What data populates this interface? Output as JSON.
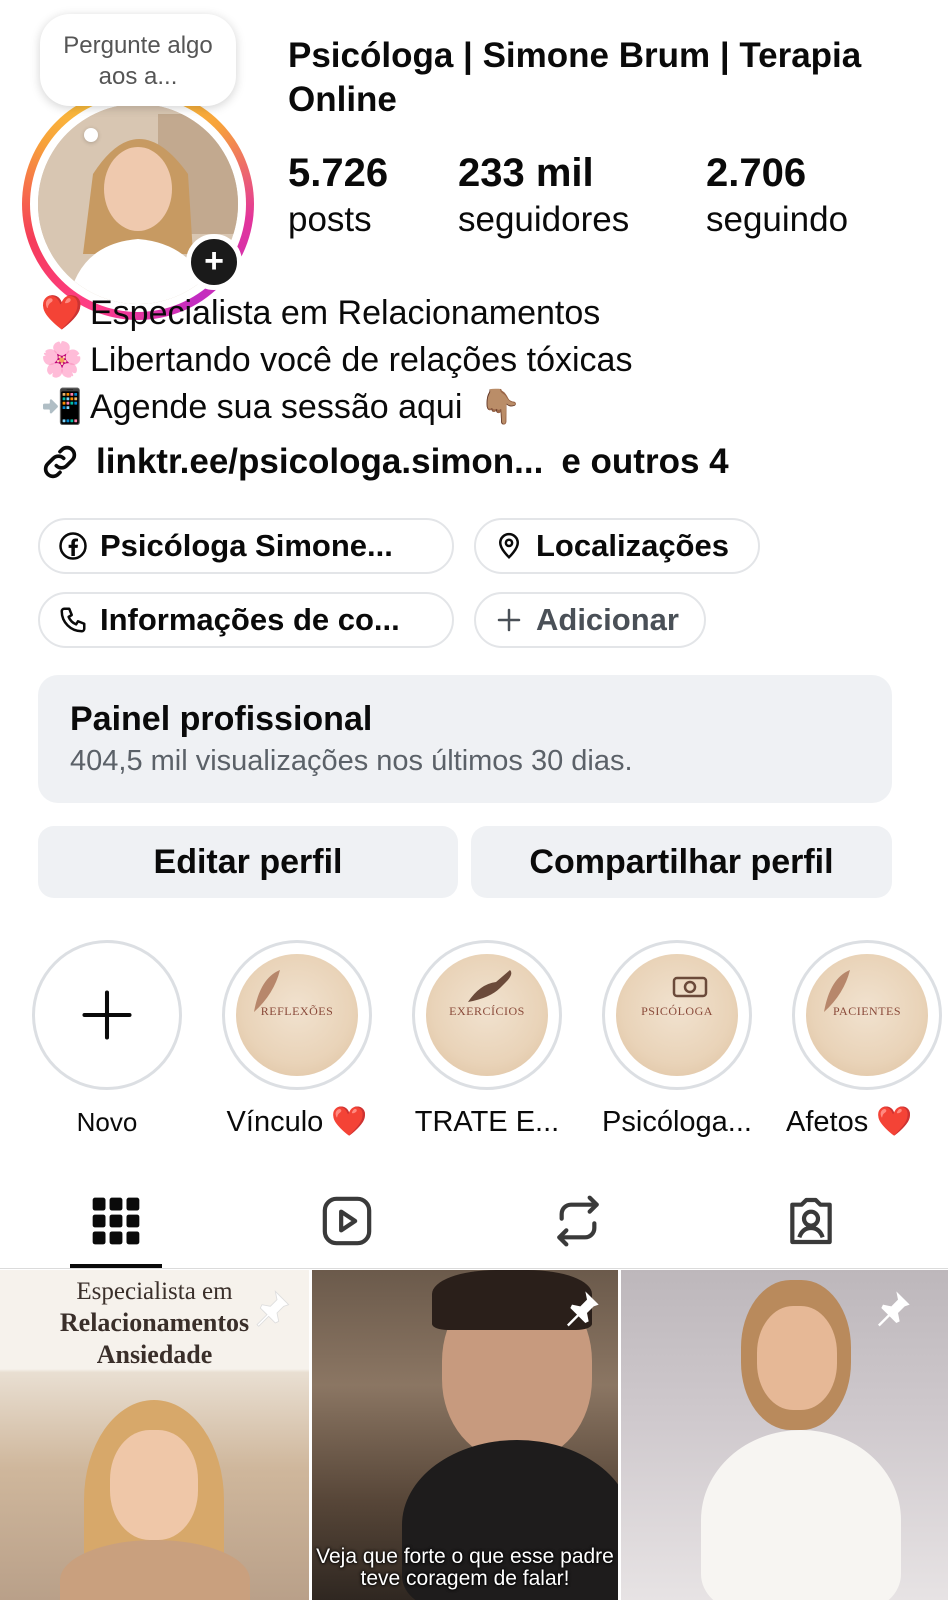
{
  "note": {
    "text": "Pergunte algo aos a..."
  },
  "profile": {
    "name": "Psicóloga | Simone Brum | Terapia Online",
    "stats": [
      {
        "value": "5.726",
        "label": "posts"
      },
      {
        "value": "233 mil",
        "label": "seguidores"
      },
      {
        "value": "2.706",
        "label": "seguindo"
      }
    ]
  },
  "bio": {
    "lines": [
      {
        "emoji": "❤️",
        "text": "Especialista em Relacionamentos"
      },
      {
        "emoji": "🌸",
        "text": "Libertando você de relações tóxicas"
      },
      {
        "emoji": "📲",
        "text": "Agende sua sessão aqui",
        "trailing_emoji": "👇🏽"
      }
    ],
    "link": "linktr.ee/psicologa.simon...",
    "link_more": "e outros 4"
  },
  "chips": [
    {
      "label": "Psicóloga Simone...",
      "icon": "facebook-icon"
    },
    {
      "label": "Localizações",
      "icon": "location-pin-icon"
    },
    {
      "label": "Informações de co...",
      "icon": "phone-icon"
    },
    {
      "label": "Adicionar",
      "icon": "plus-icon"
    }
  ],
  "dashboard": {
    "title": "Painel profissional",
    "subtitle": "404,5 mil visualizações nos últimos 30 dias."
  },
  "actions": {
    "edit": "Editar perfil",
    "share": "Compartilhar perfil"
  },
  "highlights": [
    {
      "label": "Novo"
    },
    {
      "label": "Vínculo ❤️",
      "cover_text": "REFLEXÕES"
    },
    {
      "label": "TRATE E...",
      "cover_text": "EXERCÍCIOS"
    },
    {
      "label": "Psicóloga...",
      "cover_text": "PSICÓLOGA"
    },
    {
      "label": "Afetos ❤️",
      "cover_text": "PACIENTES"
    }
  ],
  "tabs": [
    "grid-icon",
    "reels-icon",
    "reposts-icon",
    "tagged-icon"
  ],
  "posts": [
    {
      "line1": "Especialista em",
      "line2": "Relacionamentos",
      "line3": "Ansiedade"
    },
    {
      "caption": "Veja que forte o que esse padre teve coragem de falar!"
    },
    {}
  ],
  "colors": {
    "accent_bg": "#eff1f4",
    "ring_start": "#ff3d8b",
    "ring_end": "#ffd23f"
  }
}
